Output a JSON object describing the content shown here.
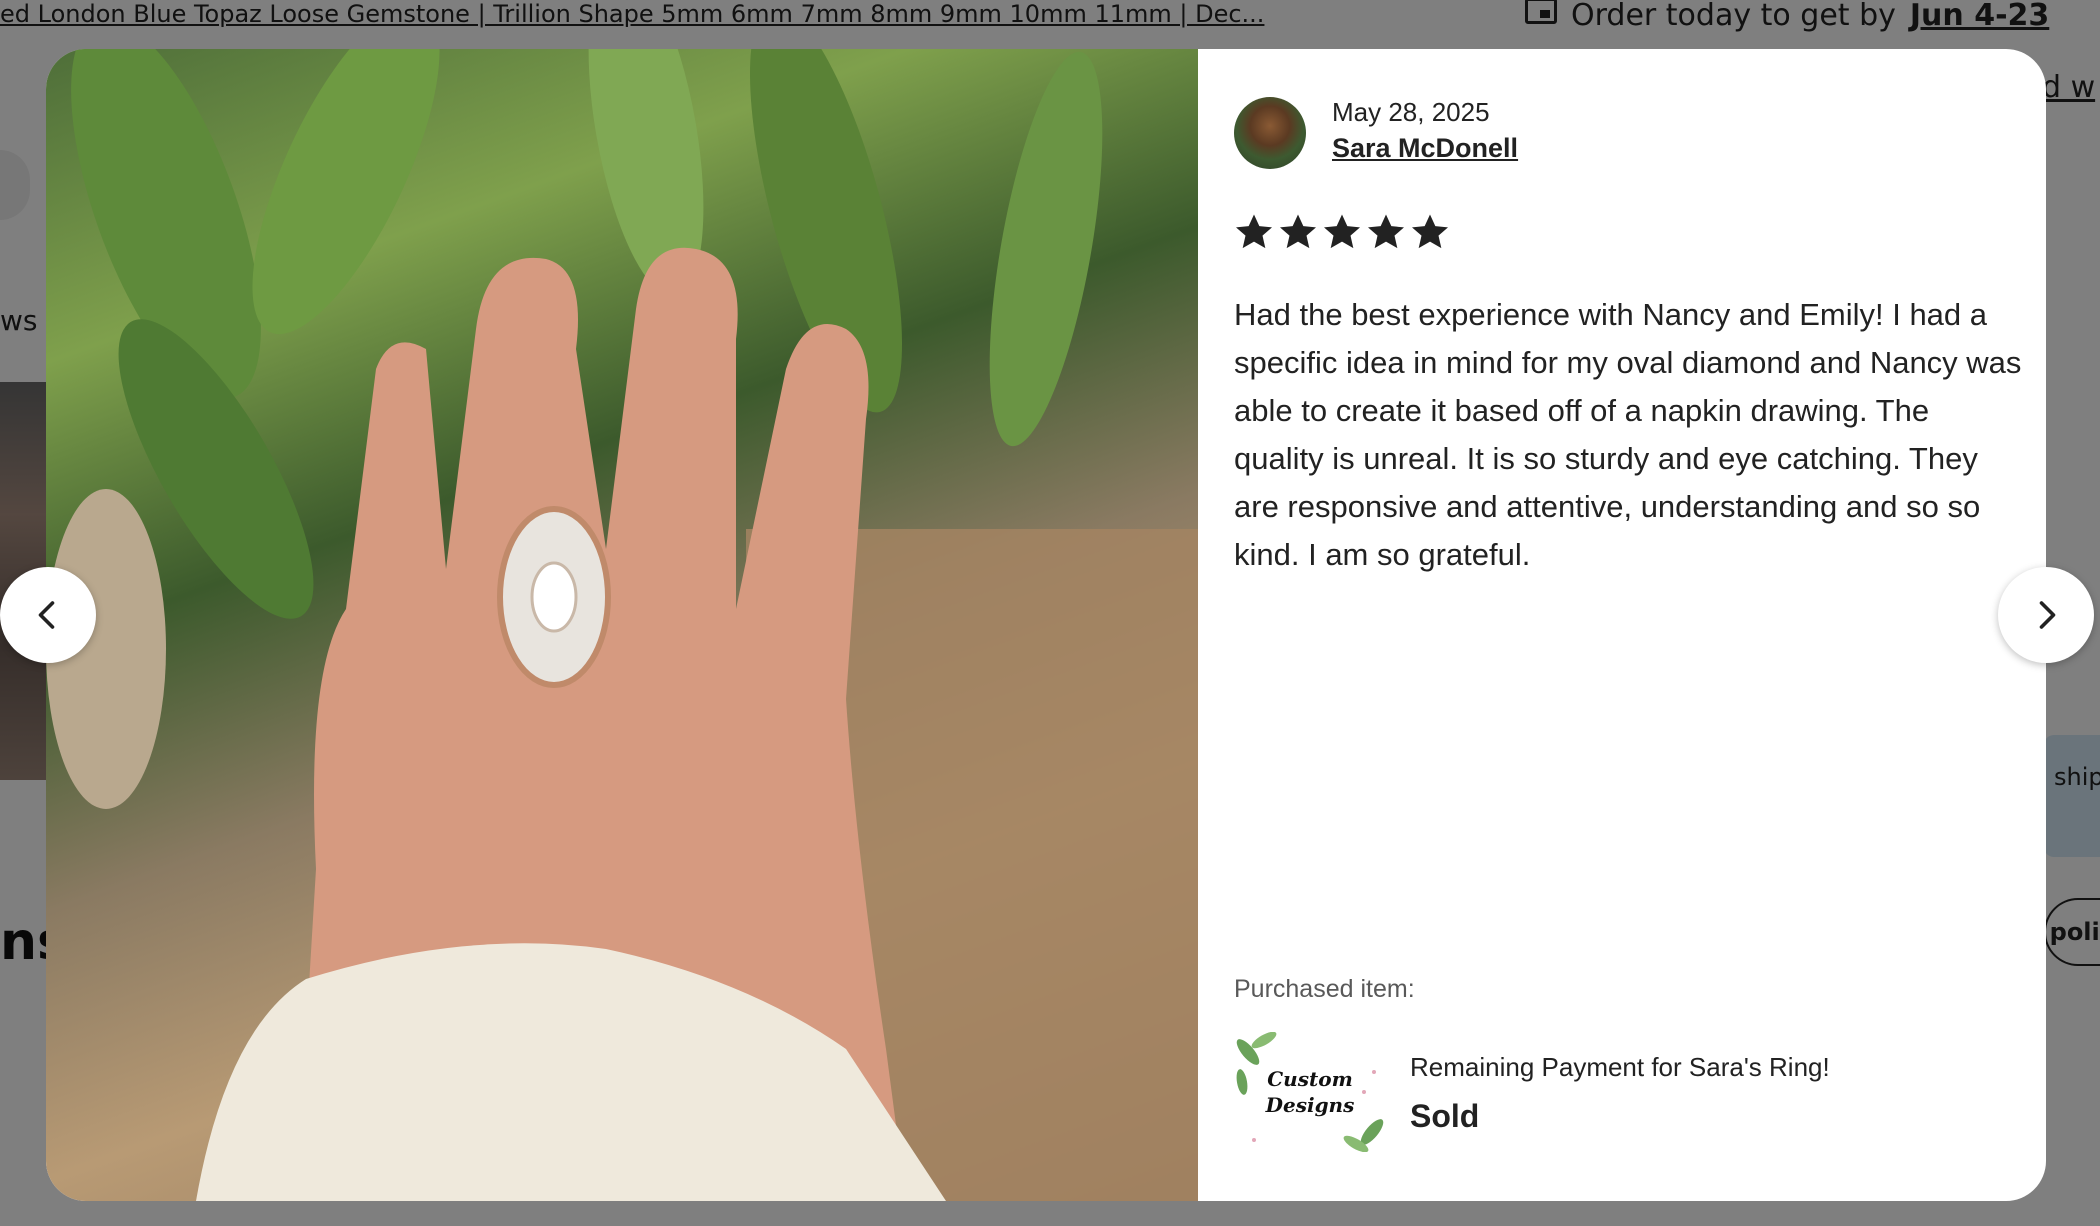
{
  "background": {
    "listing_title": "ed London Blue Topaz Loose Gemstone | Trillion Shape 5mm 6mm 7mm 8mm 9mm 10mm 11mm | Dec...",
    "order_text": "Order today to get by",
    "order_date": "Jun 4-23",
    "frag_ws": "ws",
    "frag_ns": "ns",
    "frag_dw": "d w",
    "frag_ship": "ship",
    "frag_polic": "polic"
  },
  "review": {
    "date": "May 28, 2025",
    "reviewer": "Sara McDonell",
    "rating": 5,
    "text": "Had the best experience with Nancy and Emily! I had a specific idea in mind for my oval diamond and Nancy was able to create it based off of a napkin drawing. The quality is unreal. It is so sturdy and eye catching. They are responsive and attentive, understanding and so so kind. I am so grateful."
  },
  "purchase": {
    "label": "Purchased item:",
    "thumb_text": "Custom Designs",
    "item_name": "Remaining Payment for Sara's Ring!",
    "status": "Sold"
  },
  "icons": {
    "prev": "chevron-left-icon",
    "next": "chevron-right-icon",
    "star": "star-icon",
    "calendar": "calendar-icon"
  },
  "colors": {
    "text": "#222222",
    "muted": "#595959",
    "overlay": "rgba(0,0,0,0.5)"
  }
}
